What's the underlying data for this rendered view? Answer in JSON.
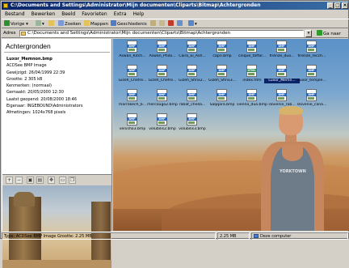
{
  "window": {
    "title": "C:\\Documents and Settings\\Administrator\\Mijn documenten\\Cliparts\\Bitmap\\Achtergronden",
    "controls": [
      "_",
      "□",
      "×"
    ]
  },
  "menu": [
    "Bestand",
    "Bewerken",
    "Beeld",
    "Favorieten",
    "Extra",
    "Help"
  ],
  "toolbar": {
    "back": "Vorige",
    "search": "Zoeken",
    "folders": "Mappen",
    "history": "Geschiedenis"
  },
  "address": {
    "label": "Adres",
    "value": "C:\\Documents and Settings\\Administrator\\Mijn documenten\\Cliparts\\Bitmap\\Achtergronden",
    "go": "Ga naar"
  },
  "left_pane": {
    "title": "Achtergronden",
    "file_name": "Luxor_Memnon.bmp",
    "file_type": "ACDSee BMP Image",
    "props": [
      "Gewijzigd: 26/04/1999 22:39",
      "Grootte: 2 305 kB",
      "Kenmerken: (normaal)",
      "Gemaakt: 20/05/2000 12:30",
      "Laatst geopend: 20/08/2000 18:46",
      "Eigenaar: INGEBOUND\\Administrators",
      "Afmetingen: 1024x768 pixels"
    ]
  },
  "files": [
    {
      "name": "Aswan_Kitch...",
      "type": "BMP"
    },
    {
      "name": "Aswan_Phila...",
      "type": "BMP"
    },
    {
      "name": "Cairo_El_Ash...",
      "type": "BMP"
    },
    {
      "name": "capri.bmp",
      "type": "BMP"
    },
    {
      "name": "cinque_taffar...",
      "type": "BMP"
    },
    {
      "name": "firenze_duo...",
      "type": "BMP"
    },
    {
      "name": "firenze_recch...",
      "type": "BMP"
    },
    {
      "name": "Gizeh_Chefre...",
      "type": "BMP"
    },
    {
      "name": "Gizeh_Chefre...",
      "type": "BMP"
    },
    {
      "name": "Gizeh_Sfinx2...",
      "type": "BMP"
    },
    {
      "name": "Gizeh_Sfinx3...",
      "type": "BMP"
    },
    {
      "name": "index.htm",
      "type": "HTML"
    },
    {
      "name": "Luxor_Memn...",
      "type": "BMP"
    },
    {
      "name": "Luxor_temple...",
      "type": "BMP"
    },
    {
      "name": "marrakech_b...",
      "type": "BMP"
    },
    {
      "name": "mercougo2.bmp",
      "type": "BMP"
    },
    {
      "name": "rabat_chella...",
      "type": "BMP"
    },
    {
      "name": "Saqqara.bmp",
      "type": "BMP"
    },
    {
      "name": "sienna_duo.bmp",
      "type": "BMP"
    },
    {
      "name": "slovenie_rab...",
      "type": "BMP"
    },
    {
      "name": "slovenie_cana...",
      "type": "BMP"
    },
    {
      "name": "venisho3.bmp",
      "type": "BMP"
    },
    {
      "name": "volubilis2.bmp",
      "type": "BMP"
    },
    {
      "name": "volubilis3.bmp",
      "type": "BMP"
    }
  ],
  "shirt_text": "YORKTOWN",
  "status": {
    "info": "Type: ACDSee BMP Image Grootte: 2.25 MB",
    "size": "2.25 MB",
    "zone": "Deze computer"
  }
}
